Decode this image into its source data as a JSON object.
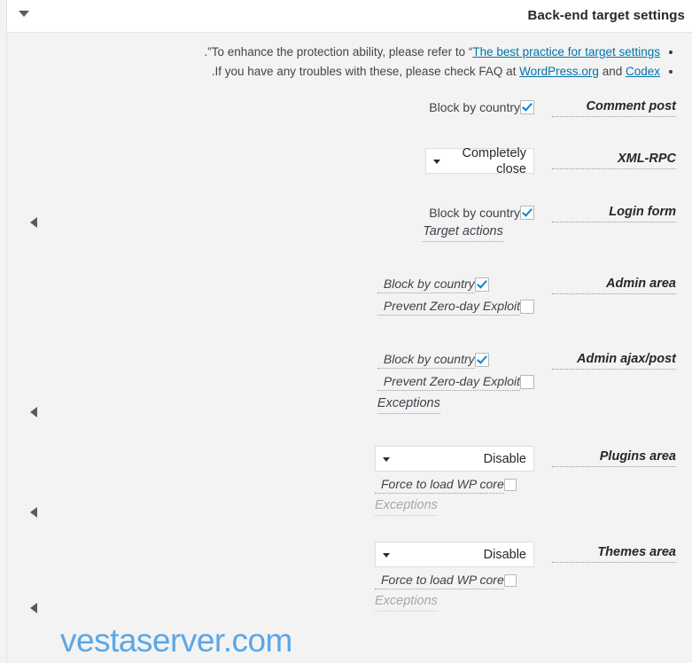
{
  "panel": {
    "title": "Back-end target settings",
    "toggle_icon": "triangle-down-icon"
  },
  "notes": [
    {
      "before": "To enhance the protection ability, please refer to “",
      "link": "The best practice for target settings",
      "after": "”."
    },
    {
      "before": "If you have any troubles with these, please check FAQ at ",
      "link": "WordPress.org",
      "mid": " and ",
      "link2": "Codex",
      "after": "."
    }
  ],
  "sections": [
    {
      "title": "Comment post",
      "checkboxes": [
        {
          "label": "Block by country",
          "checked": true,
          "hinted": false
        }
      ]
    },
    {
      "title": "XML-RPC",
      "select": {
        "value": "Completely close",
        "arrow": "triangle-down-icon"
      }
    },
    {
      "title": "Login form",
      "checkboxes": [
        {
          "label": "Block by country",
          "checked": true,
          "hinted": false
        }
      ],
      "links": [
        {
          "label": "Target actions",
          "disabled": false
        }
      ],
      "expander": "triangle-right-icon"
    },
    {
      "title": "Admin area",
      "checkboxes": [
        {
          "label": "Block by country",
          "checked": true,
          "hinted": true
        },
        {
          "label": "Prevent Zero-day Exploit",
          "checked": false,
          "hinted": true
        }
      ]
    },
    {
      "title": "Admin ajax/post",
      "checkboxes": [
        {
          "label": "Block by country",
          "checked": true,
          "hinted": true
        },
        {
          "label": "Prevent Zero-day Exploit",
          "checked": false,
          "hinted": true
        }
      ],
      "links": [
        {
          "label": "Exceptions",
          "disabled": false
        }
      ],
      "expander": "triangle-right-icon"
    },
    {
      "title": "Plugins area",
      "select": {
        "value": "Disable",
        "arrow": "triangle-down-icon"
      },
      "checkboxes": [
        {
          "label": "Force to load WP core",
          "checked": false,
          "hinted": true,
          "small": true
        }
      ],
      "links": [
        {
          "label": "Exceptions",
          "disabled": true
        }
      ],
      "expander": "triangle-right-icon"
    },
    {
      "title": "Themes area",
      "select": {
        "value": "Disable",
        "arrow": "triangle-down-icon"
      },
      "checkboxes": [
        {
          "label": "Force to load WP core",
          "checked": false,
          "hinted": true,
          "small": true
        }
      ],
      "links": [
        {
          "label": "Exceptions",
          "disabled": true
        }
      ],
      "expander": "triangle-right-icon"
    }
  ],
  "watermark": "vestaserver.com",
  "colors": {
    "accent_link": "#0073aa",
    "checkbox_check": "#0084d6",
    "panel_bg": "#f3f3f3",
    "header_bg": "#ffffff",
    "title_text": "#23282d",
    "watermark": "#5aa7e8"
  }
}
